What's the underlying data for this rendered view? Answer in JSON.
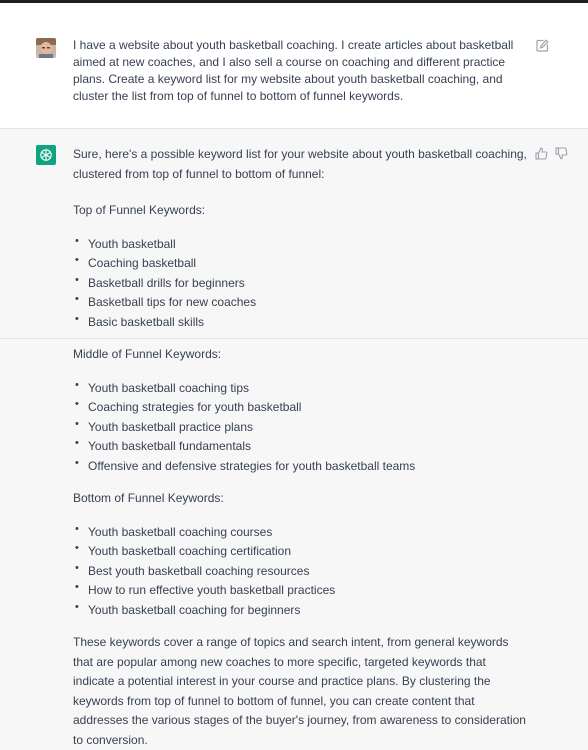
{
  "user_message": {
    "text": "I have a website about youth basketball coaching. I create articles about basketball aimed at new coaches, and I also sell a course on coaching and different practice plans. Create a keyword list for my website about youth basketball coaching, and cluster the list from top of funnel to bottom of funnel keywords."
  },
  "assistant_message": {
    "intro": "Sure, here's a possible keyword list for your website about youth basketball coaching, clustered from top of funnel to bottom of funnel:",
    "sections": [
      {
        "heading": "Top of Funnel Keywords:",
        "items": [
          "Youth basketball",
          "Coaching basketball",
          "Basketball drills for beginners",
          "Basketball tips for new coaches",
          "Basic basketball skills"
        ]
      },
      {
        "heading": "Middle of Funnel Keywords:",
        "items": [
          "Youth basketball coaching tips",
          "Coaching strategies for youth basketball",
          "Youth basketball practice plans",
          "Youth basketball fundamentals",
          "Offensive and defensive strategies for youth basketball teams"
        ]
      },
      {
        "heading": "Bottom of Funnel Keywords:",
        "items": [
          "Youth basketball coaching courses",
          "Youth basketball coaching certification",
          "Best youth basketball coaching resources",
          "How to run effective youth basketball practices",
          "Youth basketball coaching for beginners"
        ]
      }
    ],
    "outro": "These keywords cover a range of topics and search intent, from general keywords that are popular among new coaches to more specific, targeted keywords that indicate a potential interest in your course and practice plans. By clustering the keywords from top of funnel to bottom of funnel, you can create content that addresses the various stages of the buyer's journey, from awareness to consideration to conversion."
  },
  "icons": {
    "user_avatar": "user-avatar",
    "assistant_avatar": "chatgpt-logo-icon",
    "edit": "edit-icon",
    "thumbs_up": "thumbs-up-icon",
    "thumbs_down": "thumbs-down-icon"
  },
  "colors": {
    "assistant_avatar_bg": "#10a37f",
    "user_row_bg": "#ffffff",
    "assistant_row_bg": "#f7f7f8",
    "text": "#374151"
  }
}
